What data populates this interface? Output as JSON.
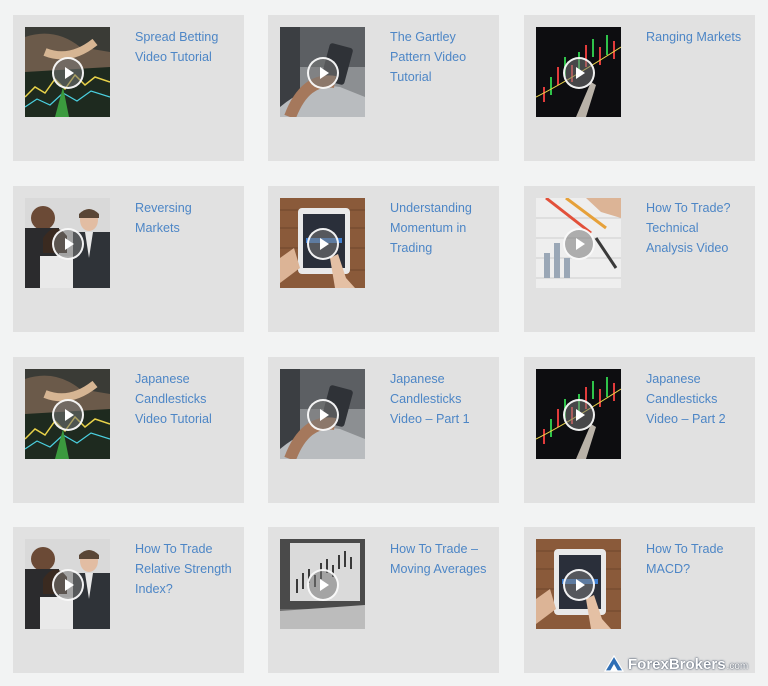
{
  "cards": [
    {
      "title": "Spread Betting Video Tutorial",
      "thumb": "trading-chart-hand"
    },
    {
      "title": "The Gartley Pattern Video Tutorial",
      "thumb": "phone-laptop"
    },
    {
      "title": "Ranging Markets",
      "thumb": "dark-candlestick-chart"
    },
    {
      "title": "Reversing Markets",
      "thumb": "business-team"
    },
    {
      "title": "Understanding Momentum in Trading",
      "thumb": "tablet-hand"
    },
    {
      "title": "How To Trade? Technical Analysis Video",
      "thumb": "pen-charts-paper"
    },
    {
      "title": "Japanese Candlesticks Video Tutorial",
      "thumb": "trading-chart-hand"
    },
    {
      "title": "Japanese Candlesticks Video – Part 1",
      "thumb": "phone-laptop"
    },
    {
      "title": "Japanese Candlesticks Video – Part 2",
      "thumb": "dark-candlestick-chart"
    },
    {
      "title": "How To Trade Relative Strength Index?",
      "thumb": "business-team"
    },
    {
      "title": "How To Trade – Moving Averages",
      "thumb": "laptop-chart-screen"
    },
    {
      "title": "How To Trade MACD?",
      "thumb": "tablet-hand"
    }
  ],
  "watermark": {
    "name": "ForexBrokers",
    "suffix": ".com"
  },
  "colors": {
    "link": "#4d86c6",
    "card": "#e1e1e1",
    "background": "#f2f3f3"
  }
}
